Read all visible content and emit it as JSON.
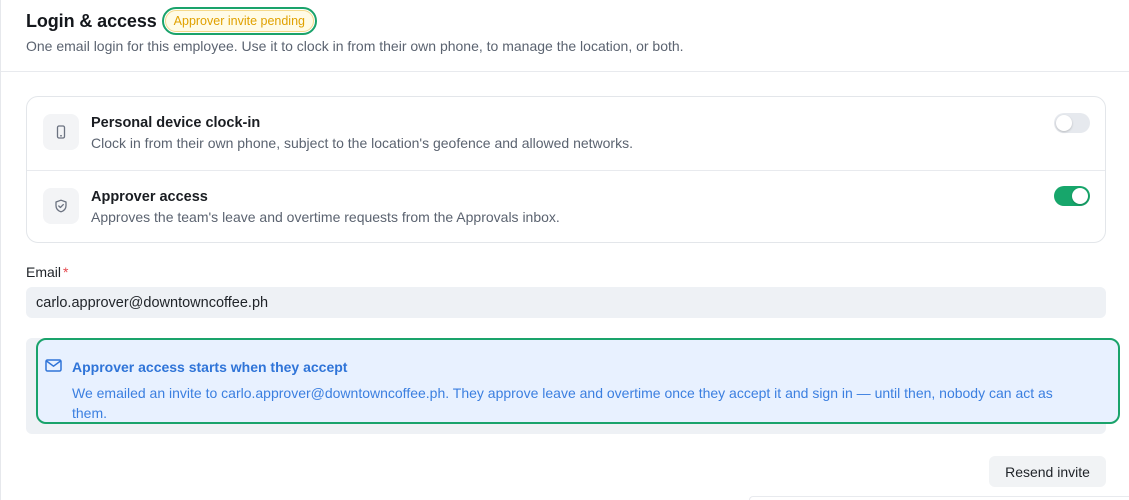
{
  "section": {
    "title": "Login & access",
    "badge": "Approver invite pending",
    "subtitle": "One email login for this employee. Use it to clock in from their own phone, to manage the location, or both."
  },
  "options": [
    {
      "icon": "phone-icon",
      "title": "Personal device clock-in",
      "description": "Clock in from their own phone, subject to the location's geofence and allowed networks.",
      "enabled": false
    },
    {
      "icon": "shield-check-icon",
      "title": "Approver access",
      "description": "Approves the team's leave and overtime requests from the Approvals inbox.",
      "enabled": true
    }
  ],
  "email": {
    "label": "Email",
    "required_mark": "*",
    "value": "carlo.approver@downtowncoffee.ph"
  },
  "notice": {
    "icon": "mail-icon",
    "title": "Approver access starts when they accept",
    "text": "We emailed an invite to carlo.approver@downtowncoffee.ph. They approve leave and overtime once they accept it and sign in — until then, nobody can act as them."
  },
  "actions": {
    "resend_label": "Resend invite"
  },
  "colors": {
    "accent_green": "#17a66b",
    "badge_text": "#e0a100",
    "notice_blue": "#2f74d8",
    "required_red": "#e5484d"
  }
}
